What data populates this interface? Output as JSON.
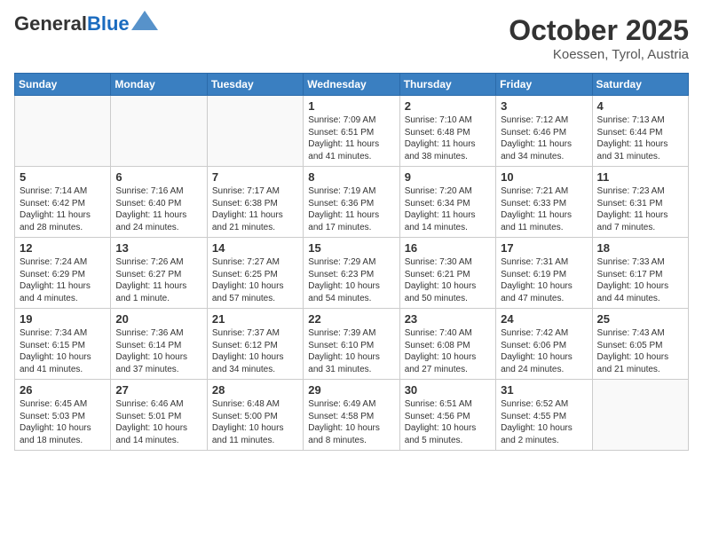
{
  "header": {
    "logo_general": "General",
    "logo_blue": "Blue",
    "month": "October 2025",
    "location": "Koessen, Tyrol, Austria"
  },
  "days_of_week": [
    "Sunday",
    "Monday",
    "Tuesday",
    "Wednesday",
    "Thursday",
    "Friday",
    "Saturday"
  ],
  "weeks": [
    [
      {
        "day": "",
        "info": ""
      },
      {
        "day": "",
        "info": ""
      },
      {
        "day": "",
        "info": ""
      },
      {
        "day": "1",
        "info": "Sunrise: 7:09 AM\nSunset: 6:51 PM\nDaylight: 11 hours\nand 41 minutes."
      },
      {
        "day": "2",
        "info": "Sunrise: 7:10 AM\nSunset: 6:48 PM\nDaylight: 11 hours\nand 38 minutes."
      },
      {
        "day": "3",
        "info": "Sunrise: 7:12 AM\nSunset: 6:46 PM\nDaylight: 11 hours\nand 34 minutes."
      },
      {
        "day": "4",
        "info": "Sunrise: 7:13 AM\nSunset: 6:44 PM\nDaylight: 11 hours\nand 31 minutes."
      }
    ],
    [
      {
        "day": "5",
        "info": "Sunrise: 7:14 AM\nSunset: 6:42 PM\nDaylight: 11 hours\nand 28 minutes."
      },
      {
        "day": "6",
        "info": "Sunrise: 7:16 AM\nSunset: 6:40 PM\nDaylight: 11 hours\nand 24 minutes."
      },
      {
        "day": "7",
        "info": "Sunrise: 7:17 AM\nSunset: 6:38 PM\nDaylight: 11 hours\nand 21 minutes."
      },
      {
        "day": "8",
        "info": "Sunrise: 7:19 AM\nSunset: 6:36 PM\nDaylight: 11 hours\nand 17 minutes."
      },
      {
        "day": "9",
        "info": "Sunrise: 7:20 AM\nSunset: 6:34 PM\nDaylight: 11 hours\nand 14 minutes."
      },
      {
        "day": "10",
        "info": "Sunrise: 7:21 AM\nSunset: 6:33 PM\nDaylight: 11 hours\nand 11 minutes."
      },
      {
        "day": "11",
        "info": "Sunrise: 7:23 AM\nSunset: 6:31 PM\nDaylight: 11 hours\nand 7 minutes."
      }
    ],
    [
      {
        "day": "12",
        "info": "Sunrise: 7:24 AM\nSunset: 6:29 PM\nDaylight: 11 hours\nand 4 minutes."
      },
      {
        "day": "13",
        "info": "Sunrise: 7:26 AM\nSunset: 6:27 PM\nDaylight: 11 hours\nand 1 minute."
      },
      {
        "day": "14",
        "info": "Sunrise: 7:27 AM\nSunset: 6:25 PM\nDaylight: 10 hours\nand 57 minutes."
      },
      {
        "day": "15",
        "info": "Sunrise: 7:29 AM\nSunset: 6:23 PM\nDaylight: 10 hours\nand 54 minutes."
      },
      {
        "day": "16",
        "info": "Sunrise: 7:30 AM\nSunset: 6:21 PM\nDaylight: 10 hours\nand 50 minutes."
      },
      {
        "day": "17",
        "info": "Sunrise: 7:31 AM\nSunset: 6:19 PM\nDaylight: 10 hours\nand 47 minutes."
      },
      {
        "day": "18",
        "info": "Sunrise: 7:33 AM\nSunset: 6:17 PM\nDaylight: 10 hours\nand 44 minutes."
      }
    ],
    [
      {
        "day": "19",
        "info": "Sunrise: 7:34 AM\nSunset: 6:15 PM\nDaylight: 10 hours\nand 41 minutes."
      },
      {
        "day": "20",
        "info": "Sunrise: 7:36 AM\nSunset: 6:14 PM\nDaylight: 10 hours\nand 37 minutes."
      },
      {
        "day": "21",
        "info": "Sunrise: 7:37 AM\nSunset: 6:12 PM\nDaylight: 10 hours\nand 34 minutes."
      },
      {
        "day": "22",
        "info": "Sunrise: 7:39 AM\nSunset: 6:10 PM\nDaylight: 10 hours\nand 31 minutes."
      },
      {
        "day": "23",
        "info": "Sunrise: 7:40 AM\nSunset: 6:08 PM\nDaylight: 10 hours\nand 27 minutes."
      },
      {
        "day": "24",
        "info": "Sunrise: 7:42 AM\nSunset: 6:06 PM\nDaylight: 10 hours\nand 24 minutes."
      },
      {
        "day": "25",
        "info": "Sunrise: 7:43 AM\nSunset: 6:05 PM\nDaylight: 10 hours\nand 21 minutes."
      }
    ],
    [
      {
        "day": "26",
        "info": "Sunrise: 6:45 AM\nSunset: 5:03 PM\nDaylight: 10 hours\nand 18 minutes."
      },
      {
        "day": "27",
        "info": "Sunrise: 6:46 AM\nSunset: 5:01 PM\nDaylight: 10 hours\nand 14 minutes."
      },
      {
        "day": "28",
        "info": "Sunrise: 6:48 AM\nSunset: 5:00 PM\nDaylight: 10 hours\nand 11 minutes."
      },
      {
        "day": "29",
        "info": "Sunrise: 6:49 AM\nSunset: 4:58 PM\nDaylight: 10 hours\nand 8 minutes."
      },
      {
        "day": "30",
        "info": "Sunrise: 6:51 AM\nSunset: 4:56 PM\nDaylight: 10 hours\nand 5 minutes."
      },
      {
        "day": "31",
        "info": "Sunrise: 6:52 AM\nSunset: 4:55 PM\nDaylight: 10 hours\nand 2 minutes."
      },
      {
        "day": "",
        "info": ""
      }
    ]
  ]
}
